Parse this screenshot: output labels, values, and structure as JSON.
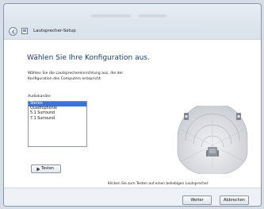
{
  "window": {
    "title": "Lautsprecher-Setup"
  },
  "page": {
    "heading": "Wählen Sie Ihre Konfiguration aus.",
    "description": "Wählen Sie die Lautsprechereinrichtung aus, die der Konfiguration des Computers entspricht.",
    "audio_channels_label": "Audiokanäle:",
    "audio_channels": [
      "Stereo",
      "Quadrophonie",
      "5.1 Surround",
      "7.1 Surround"
    ],
    "selected_channel": "Stereo",
    "test_button": "Testen",
    "hint": "Klicken Sie zum Testen auf einen beliebigen Lautsprecher."
  },
  "footer": {
    "next_button": "Weiter",
    "cancel_button": "Abbrechen"
  }
}
